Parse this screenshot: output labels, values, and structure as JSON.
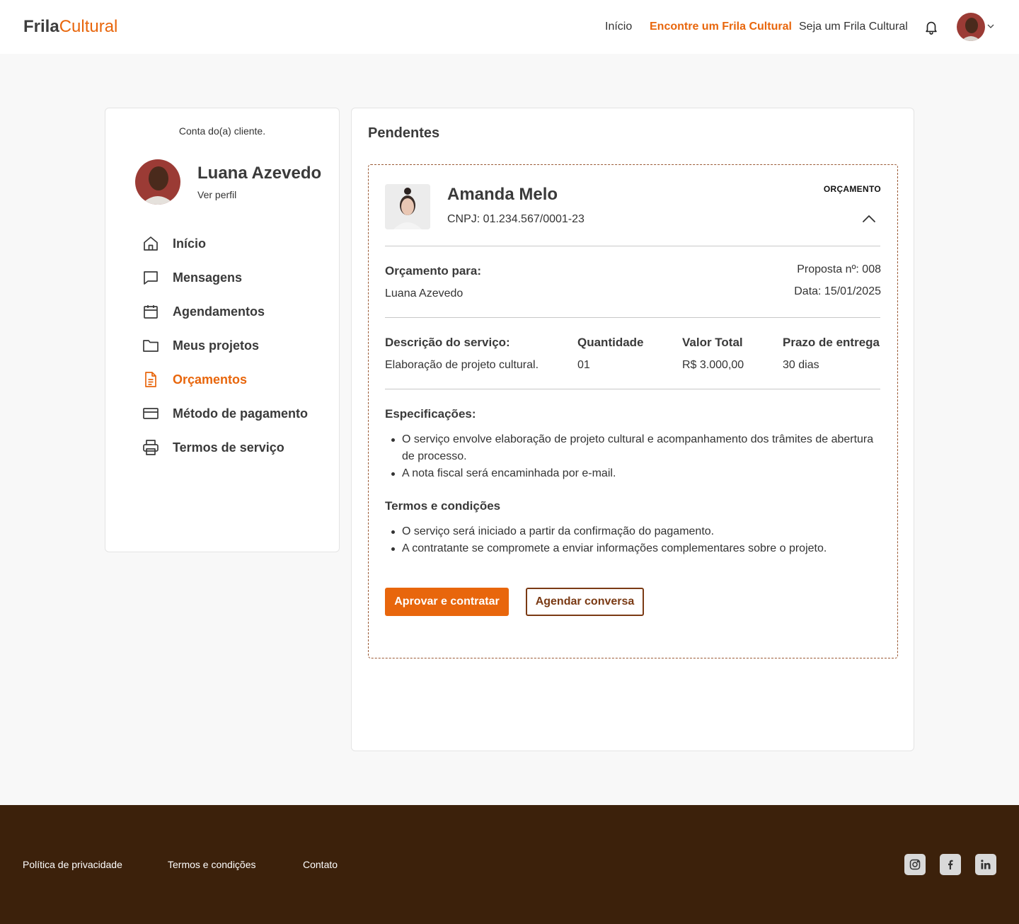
{
  "header": {
    "logo_part1": "Frila",
    "logo_part2": "Cultural",
    "nav": [
      {
        "label": "Início"
      },
      {
        "label": "Encontre um Frila Cultural"
      },
      {
        "label": "Seja um Frila Cultural"
      }
    ]
  },
  "sidebar": {
    "account_type": "Conta do(a) cliente.",
    "user_name": "Luana Azevedo",
    "view_profile": "Ver perfil",
    "items": [
      {
        "label": "Início",
        "icon": "home-icon"
      },
      {
        "label": "Mensagens",
        "icon": "message-icon"
      },
      {
        "label": "Agendamentos",
        "icon": "calendar-icon"
      },
      {
        "label": "Meus projetos",
        "icon": "folder-icon"
      },
      {
        "label": "Orçamentos",
        "icon": "document-icon",
        "active": true
      },
      {
        "label": "Método de pagamento",
        "icon": "credit-card-icon"
      },
      {
        "label": "Termos de serviço",
        "icon": "printer-icon"
      }
    ]
  },
  "main": {
    "title": "Pendentes",
    "quote": {
      "provider_name": "Amanda Melo",
      "cnpj": "CNPJ: 01.234.567/0001-23",
      "tag": "ORÇAMENTO",
      "for_label": "Orçamento para:",
      "for_name": "Luana Azevedo",
      "proposal": "Proposta nº: 008",
      "date": "Data: 15/01/2025",
      "columns": {
        "description": "Descrição do serviço:",
        "quantity": "Quantidade",
        "total": "Valor Total",
        "deadline": "Prazo de entrega"
      },
      "row": {
        "description": "Elaboração de projeto cultural.",
        "quantity": "01",
        "total": "R$ 3.000,00",
        "deadline": "30 dias"
      },
      "specs_title": "Especificações:",
      "specs": [
        "O serviço envolve elaboração de projeto cultural e acompanhamento dos trâmites de abertura de processo.",
        "A nota fiscal será encaminhada por e-mail."
      ],
      "terms_title": "Termos e condições",
      "terms": [
        "O serviço será iniciado a partir da confirmação do pagamento.",
        "A contratante se compromete a enviar informações complementares sobre o projeto."
      ],
      "approve_button": "Aprovar e contratar",
      "schedule_button": "Agendar conversa"
    }
  },
  "footer": {
    "links": [
      "Política de privacidade",
      "Termos e condições",
      "Contato"
    ],
    "social": [
      "instagram-icon",
      "facebook-icon",
      "linkedin-icon"
    ]
  },
  "colors": {
    "accent": "#e8660c",
    "brown": "#7a3a14",
    "footer_bg": "#3c210b"
  }
}
